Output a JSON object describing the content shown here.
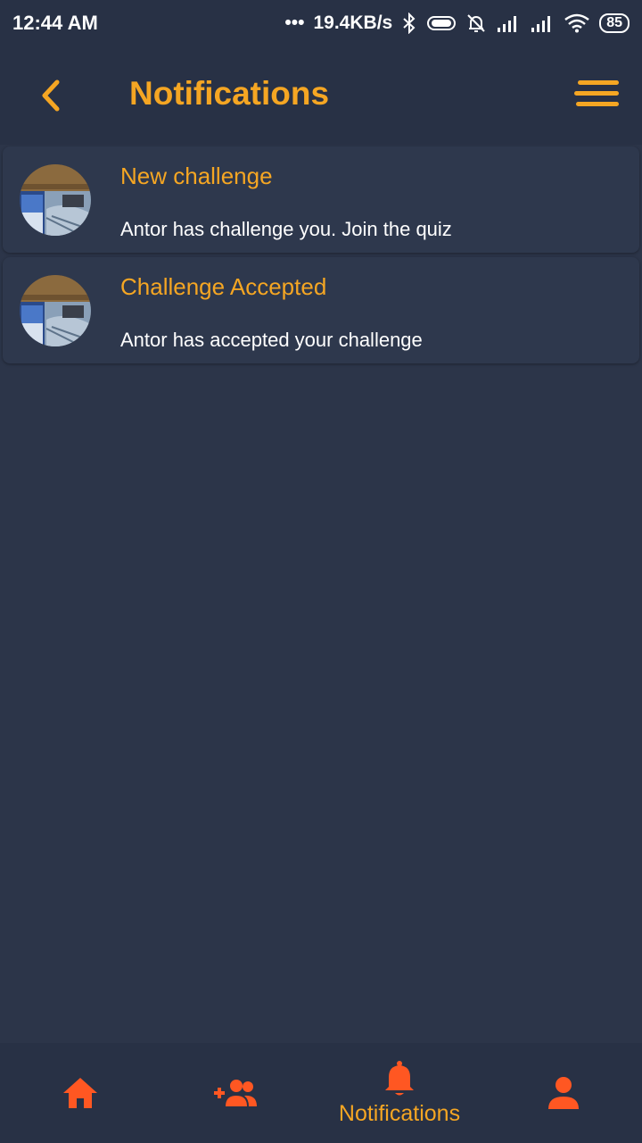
{
  "status_bar": {
    "time": "12:44 AM",
    "dots": "•••",
    "network_speed": "19.4KB/s",
    "battery": "85",
    "icons": [
      "bluetooth-icon",
      "vibrate-icon",
      "alarm-off-icon",
      "signal-icon",
      "signal-icon",
      "wifi-icon",
      "battery-icon"
    ]
  },
  "header": {
    "title": "Notifications",
    "back_icon": "chevron-left-icon",
    "menu_icon": "sort-lines-icon"
  },
  "notifications": [
    {
      "title": "New challenge",
      "body": "Antor has challenge you. Join the quiz",
      "avatar": "user-photo"
    },
    {
      "title": "Challenge Accepted",
      "body": "Antor has accepted your challenge",
      "avatar": "user-photo"
    }
  ],
  "bottom_nav": {
    "items": [
      {
        "icon": "home-icon",
        "label": ""
      },
      {
        "icon": "add-friend-icon",
        "label": ""
      },
      {
        "icon": "bell-icon",
        "label": "Notifications",
        "active": true
      },
      {
        "icon": "person-icon",
        "label": ""
      }
    ]
  },
  "colors": {
    "background": "#2c3549",
    "bar": "#283145",
    "accent": "#f5a623",
    "nav_icon": "#ff5722",
    "text": "#ffffff"
  }
}
